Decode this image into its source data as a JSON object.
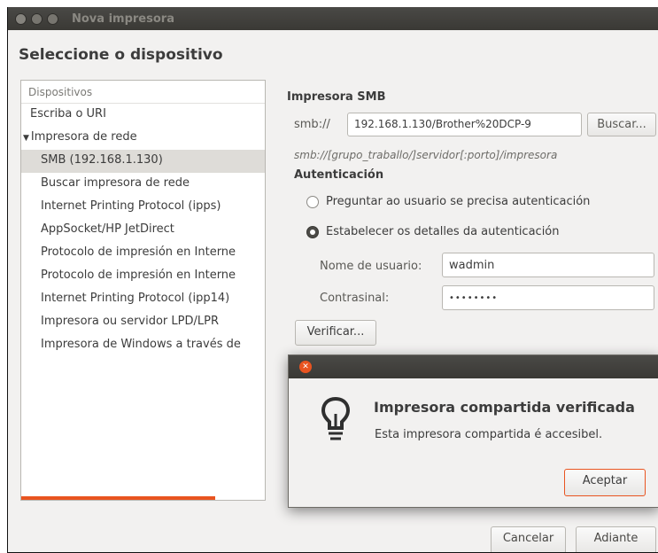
{
  "window": {
    "title": "Nova impresora"
  },
  "heading": "Seleccione o dispositivo",
  "devices": {
    "header": "Dispositivos",
    "items": [
      {
        "label": "Escriba o URI",
        "level": 0
      },
      {
        "label": "Impresora de rede",
        "level": 0,
        "expanded": true
      },
      {
        "label": "SMB (192.168.1.130)",
        "level": 1,
        "selected": true
      },
      {
        "label": "Buscar impresora de rede",
        "level": 1
      },
      {
        "label": "Internet Printing Protocol (ipps)",
        "level": 1
      },
      {
        "label": "AppSocket/HP JetDirect",
        "level": 1
      },
      {
        "label": "Protocolo de impresión en Interne",
        "level": 1
      },
      {
        "label": "Protocolo de impresión en Interne",
        "level": 1
      },
      {
        "label": "Internet Printing Protocol (ipp14)",
        "level": 1
      },
      {
        "label": "Impresora ou servidor LPD/LPR",
        "level": 1
      },
      {
        "label": "Impresora de Windows a través de",
        "level": 1
      }
    ]
  },
  "smb": {
    "title": "Impresora SMB",
    "prefix": "smb://",
    "value": "192.168.1.130/Brother%20DCP-9",
    "browse_label": "Buscar...",
    "hint": "smb://[grupo_traballo/]servidor[:porto]/impresora"
  },
  "auth": {
    "title": "Autenticación",
    "option_ask": "Preguntar ao usuario se precisa autenticación",
    "option_set": "Estabelecer os detalles da autenticación",
    "selected": "set",
    "username_label": "Nome de usuario:",
    "username": "wadmin",
    "password_label": "Contrasinal:",
    "password_mask": "••••••••",
    "verify_label": "Verificar..."
  },
  "buttons": {
    "cancel": "Cancelar",
    "forward": "Adiante"
  },
  "dialog": {
    "title": "Impresora compartida verificada",
    "message": "Esta impresora compartida é accesibel.",
    "ok": "Aceptar"
  },
  "colors": {
    "accent": "#e95420",
    "titlebar": "#3c3b37"
  }
}
